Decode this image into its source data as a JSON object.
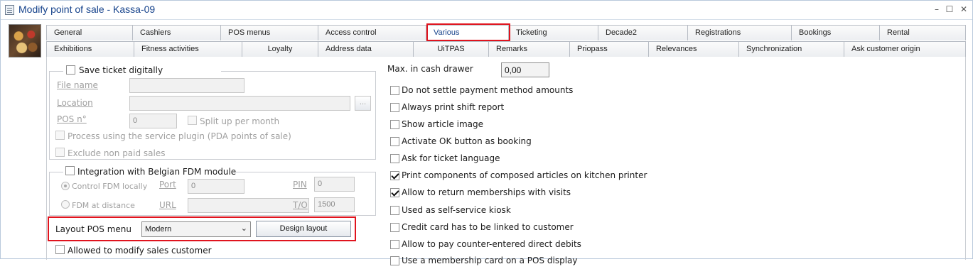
{
  "window": {
    "title": "Modify point of sale - Kassa-09",
    "controls": [
      "–",
      "☐",
      "✕"
    ]
  },
  "tabs": {
    "row1": [
      "General",
      "Cashiers",
      "POS menus",
      "Access control",
      "Various",
      "Ticketing",
      "Decade2",
      "Registrations",
      "Bookings",
      "Rental"
    ],
    "row2": [
      "Exhibitions",
      "Fitness activities",
      "Loyalty",
      "Address data",
      "UiTPAS",
      "Remarks",
      "Priopass",
      "Relevances",
      "Synchronization",
      "Ask customer origin"
    ]
  },
  "ticket_group": {
    "title": "Save ticket digitally",
    "file_name_label": "File name",
    "file_name_value": "",
    "location_label": "Location",
    "location_value": "",
    "browse_label": "...",
    "pos_no_label": "POS n°",
    "pos_no_value": "0",
    "split_label": "Split up per month",
    "service_plugin_label": "Process using the service plugin (PDA points of sale)",
    "exclude_label": "Exclude non paid sales"
  },
  "fdm_group": {
    "title": "Integration with Belgian FDM module",
    "control_local_label": "Control FDM locally",
    "distance_label": "FDM at distance",
    "port_label": "Port",
    "port_value": "0",
    "url_label": "URL",
    "url_value": "",
    "pin_label": "PIN",
    "pin_value": "0",
    "to_label": "T/O",
    "to_value": "1500"
  },
  "layout": {
    "label": "Layout POS menu",
    "selected": "Modern",
    "design_button": "Design layout"
  },
  "allowed_modify_label": "Allowed to modify sales customer",
  "cash_drawer": {
    "label": "Max. in cash drawer",
    "value": "0,00"
  },
  "options": [
    {
      "label": "Do not settle payment method amounts",
      "checked": false
    },
    {
      "label": "Always print shift report",
      "checked": false
    },
    {
      "label": "Show article image",
      "checked": false
    },
    {
      "label": "Activate OK button as booking",
      "checked": false
    },
    {
      "label": "Ask for ticket language",
      "checked": false
    },
    {
      "label": "Print components of composed articles on kitchen printer",
      "checked": true
    },
    {
      "label": "Allow to return memberships with visits",
      "checked": true
    },
    {
      "label": "Used as self-service kiosk",
      "checked": false
    },
    {
      "label": "Credit card has to be linked to customer",
      "checked": false
    },
    {
      "label": "Allow to pay counter-entered direct debits",
      "checked": false
    },
    {
      "label": "Use a membership card on a POS display",
      "checked": false
    }
  ],
  "colors": {
    "highlight": "#e0141e",
    "title": "#15428b"
  }
}
